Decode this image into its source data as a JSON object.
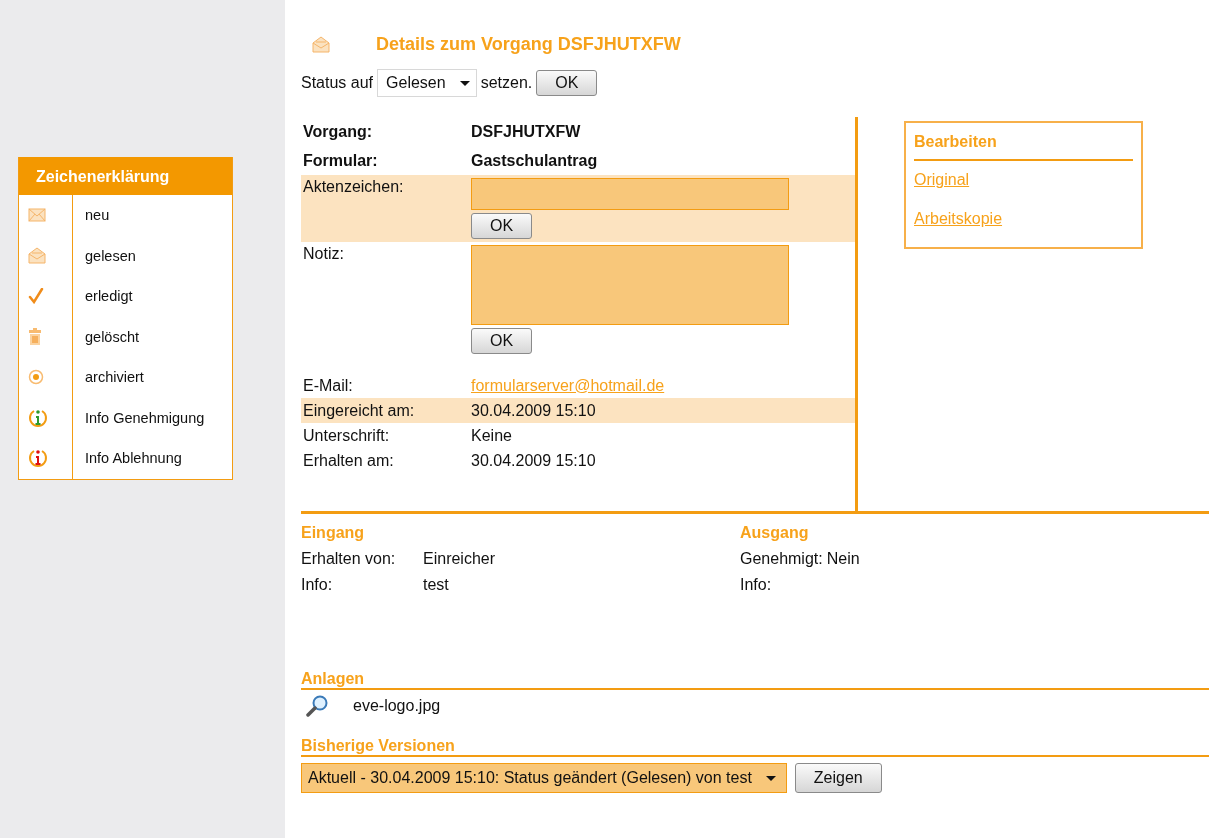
{
  "legend": {
    "title": "Zeichenerklärung",
    "items": [
      {
        "kind": "new",
        "label": "neu"
      },
      {
        "kind": "read",
        "label": "gelesen"
      },
      {
        "kind": "done",
        "label": "erledigt"
      },
      {
        "kind": "deleted",
        "label": "gelöscht"
      },
      {
        "kind": "archived",
        "label": "archiviert"
      },
      {
        "kind": "info-approved",
        "label": "Info Genehmigung"
      },
      {
        "kind": "info-rejected",
        "label": "Info Ablehnung"
      }
    ]
  },
  "header": {
    "title": "Details zum Vorgang DSFJHUTXFW"
  },
  "status_form": {
    "prefix": "Status auf",
    "value": "Gelesen",
    "suffix": "setzen.",
    "button": "OK"
  },
  "details": [
    {
      "kind": "bold",
      "label": "Vorgang:",
      "value": "DSFJHUTXFW",
      "highlighted": false
    },
    {
      "kind": "bold",
      "label": "Formular:",
      "value": "Gastschulantrag",
      "highlighted": false
    },
    {
      "kind": "input",
      "label": "Aktenzeichen:",
      "button": "OK",
      "highlighted": true
    },
    {
      "kind": "textarea",
      "label": "Notiz:",
      "button": "OK",
      "highlighted": false
    },
    {
      "kind": "link",
      "label": "E-Mail:",
      "value": "formularserver@hotmail.de",
      "highlighted": false
    },
    {
      "kind": "text",
      "label": "Eingereicht am:",
      "value": "30.04.2009 15:10",
      "highlighted": true
    },
    {
      "kind": "text",
      "label": "Unterschrift:",
      "value": "Keine",
      "highlighted": false
    },
    {
      "kind": "text",
      "label": "Erhalten am:",
      "value": "30.04.2009 15:10",
      "highlighted": false
    }
  ],
  "edit_box": {
    "title": "Bearbeiten",
    "links": [
      "Original",
      "Arbeitskopie"
    ]
  },
  "eingang": {
    "heading": "Eingang",
    "rows": [
      {
        "label": "Erhalten von:",
        "value": "Einreicher"
      },
      {
        "label": "Info:",
        "value": "test"
      }
    ]
  },
  "ausgang": {
    "heading": "Ausgang",
    "rows": [
      {
        "label": "Genehmigt:",
        "value": "Nein"
      },
      {
        "label": "Info:"
      }
    ]
  },
  "attachments": {
    "heading": "Anlagen",
    "files": [
      "eve-logo.jpg"
    ]
  },
  "versions": {
    "heading": "Bisherige Versionen",
    "value": "Aktuell - 30.04.2009 15:10: Status geändert (Gelesen) von test",
    "button": "Zeigen"
  }
}
